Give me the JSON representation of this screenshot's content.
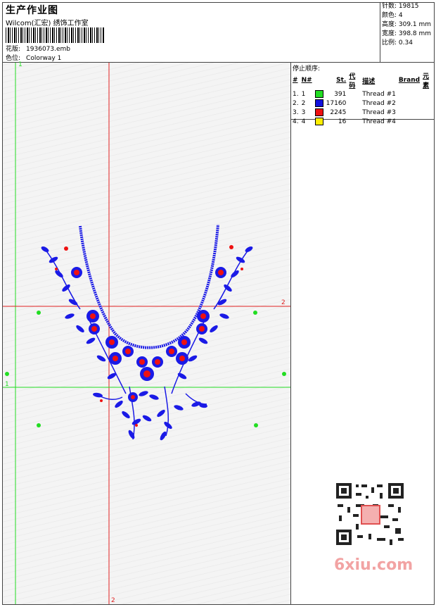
{
  "header": {
    "title": "生产作业图",
    "studio": "Wilcom(汇宏) 绣饰工作室",
    "file_label": "花版:",
    "file_value": "1936073.emb",
    "colorway_label": "色位:",
    "colorway_value": "Colorway 1"
  },
  "stats": {
    "stitches": "针数: 19815",
    "colors": "颜色: 4",
    "height": "高度: 309.1 mm",
    "width": "宽度: 398.8 mm",
    "scale": "比例: 0.34"
  },
  "legend": {
    "caption": "停止顺序:",
    "headers": [
      "#",
      "N#",
      "St.",
      "代码",
      "描述",
      "Brand",
      "元素"
    ],
    "rows": [
      {
        "idx": "1.",
        "n": "1",
        "color": "#22dd22",
        "st": "391",
        "desc": "Thread #1"
      },
      {
        "idx": "2.",
        "n": "2",
        "color": "#1111dd",
        "st": "17160",
        "desc": "Thread #2"
      },
      {
        "idx": "3.",
        "n": "3",
        "color": "#ee1111",
        "st": "2245",
        "desc": "Thread #3"
      },
      {
        "idx": "4.",
        "n": "4",
        "color": "#ffee00",
        "st": "16",
        "desc": "Thread #4"
      }
    ]
  },
  "guides": {
    "v1": "1",
    "h2": "2",
    "h1": "1",
    "v2": "2"
  },
  "colors": {
    "red_guide": "#e02020",
    "green_guide": "#22dd22",
    "embroidery_blue": "#1a1ae6",
    "embroidery_red": "#ee1111"
  },
  "watermark": "6xiu.com"
}
